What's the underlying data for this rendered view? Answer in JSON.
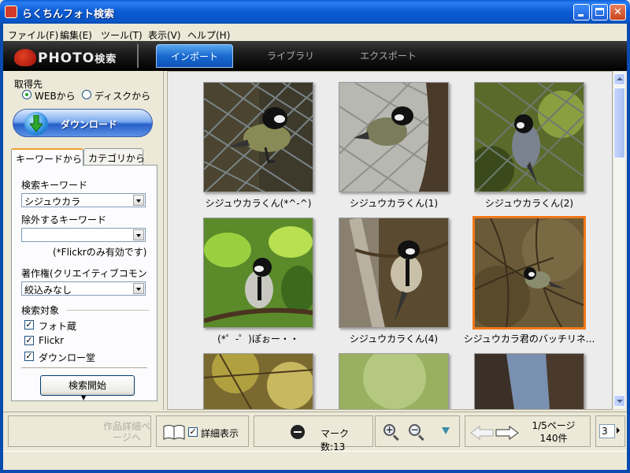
{
  "window": {
    "title": "らくちんフォト検索"
  },
  "menu": [
    "ファイル(F)",
    "編集(E)",
    "ツール(T)",
    "表示(V)",
    "ヘルプ(H)"
  ],
  "toolbar": {
    "logo_text": "PHOTO",
    "logo_suffix": "検索",
    "tabs": [
      "インポート",
      "ライブラリ",
      "エクスポート"
    ],
    "active_tab": "インポート"
  },
  "left": {
    "source_label": "取得先",
    "source_options": [
      "WEBから",
      "ディスクから"
    ],
    "source_selected": "WEBから",
    "download_label": "ダウンロード",
    "tabs": [
      "キーワードから",
      "カテゴリから"
    ],
    "keyword_label": "検索キーワード",
    "keyword_value": "シジュウカラ",
    "exclude_label": "除外するキーワード",
    "exclude_value": "",
    "flickr_note": "(*Flickrのみ有効です)",
    "license_label": "著作権(クリエイティブコモンズ)",
    "license_value": "絞込みなし",
    "target_label": "検索対象",
    "targets": [
      {
        "label": "フォト蔵",
        "checked": true
      },
      {
        "label": "Flickr",
        "checked": true
      },
      {
        "label": "ダウンロー堂",
        "checked": true
      }
    ],
    "search_button": "検索開始"
  },
  "photos": [
    {
      "caption": "シジュウカラくん(*^-^)",
      "selected": false
    },
    {
      "caption": "シジュウカラくん(1)",
      "selected": false
    },
    {
      "caption": "シジュウカラくん(2)",
      "selected": false
    },
    {
      "caption": "(*゜-゜)ぽぉー・・",
      "selected": false
    },
    {
      "caption": "シジュウカラくん(4)",
      "selected": false
    },
    {
      "caption": "シジュウカラ君のバッチリネ...",
      "selected": true
    },
    {
      "caption": "",
      "selected": false
    },
    {
      "caption": "",
      "selected": false
    },
    {
      "caption": "",
      "selected": false
    }
  ],
  "bottom": {
    "detail_link": "作品詳細ページへ",
    "detail_view_label": "詳細表示",
    "mark_count": "マーク数:13",
    "page_info": "1/5ページ",
    "item_count": "140件",
    "per_row": "3"
  },
  "colors": {
    "selected_border": "#f07818",
    "titlebar": "#0a5ad4"
  }
}
